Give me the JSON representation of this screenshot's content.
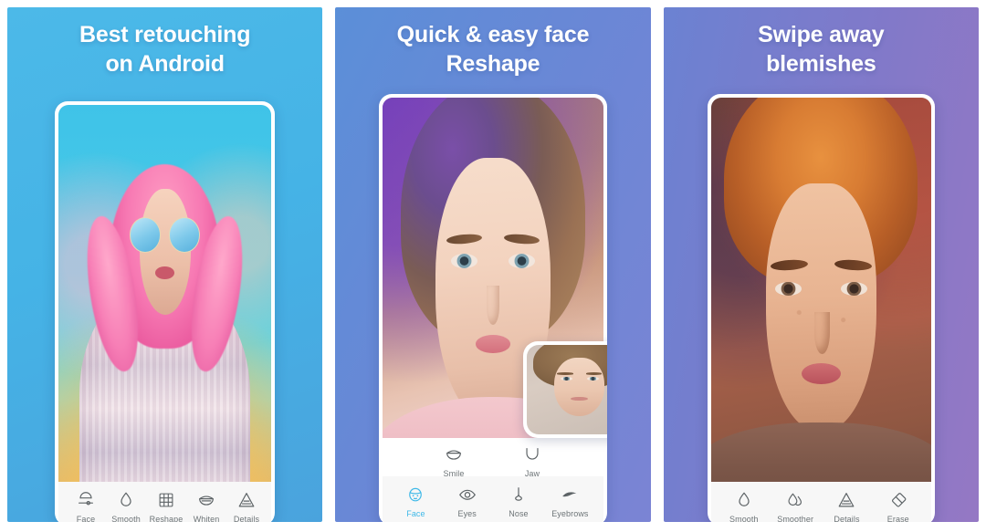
{
  "screenshot": {
    "kind": "app-store-screenshot-strip",
    "panel_count": 3,
    "background": "#ffffff"
  },
  "panels": [
    {
      "id": "panel-best-retouching",
      "headline": "Best retouching\non Android",
      "bg_from": "#4cb9e8",
      "bg_to": "#4aa3dd",
      "photo_alt": "Woman with pink wavy hair, blue tinted round sunglasses, striped pastel sweater on cyan background",
      "toolbar": {
        "rows": 1,
        "active_index": -1,
        "items": [
          {
            "label": "Face",
            "icon": "face-slider-icon",
            "active": false
          },
          {
            "label": "Smooth",
            "icon": "droplet-icon",
            "active": false
          },
          {
            "label": "Reshape",
            "icon": "grid-mesh-icon",
            "active": false
          },
          {
            "label": "Whiten",
            "icon": "teeth-smile-icon",
            "active": false
          },
          {
            "label": "Details",
            "icon": "triangle-layers-icon",
            "active": false
          }
        ]
      }
    },
    {
      "id": "panel-face-reshape",
      "headline": "Quick & easy face\nReshape",
      "bg_from": "#5b8fd8",
      "bg_to": "#7b84d4",
      "photo_alt": "Close-up of woman with light brown hair and purple rim lighting wearing a pink shirt",
      "thumbnail": {
        "label": "before-after-preview",
        "alt": "Small rounded preview of the same woman's face"
      },
      "toolbar": {
        "rows": 2,
        "sub_row": [
          {
            "label": "Smile",
            "icon": "smile-mouth-icon",
            "active": false
          },
          {
            "label": "Jaw",
            "icon": "jaw-outline-icon",
            "active": false
          }
        ],
        "main_row": [
          {
            "label": "Face",
            "icon": "face-head-icon",
            "active": true
          },
          {
            "label": "Eyes",
            "icon": "eye-icon",
            "active": false
          },
          {
            "label": "Nose",
            "icon": "nose-icon",
            "active": false
          },
          {
            "label": "Eyebrows",
            "icon": "eyebrow-icon",
            "active": false
          }
        ],
        "active_label": "Face",
        "active_color": "#3fb9e8"
      }
    },
    {
      "id": "panel-swipe-blemishes",
      "headline": "Swipe away\nblemishes",
      "bg_from": "#6b82d2",
      "bg_to": "#9578c4",
      "photo_alt": "Close-up of freckled woman with curly auburn hair in warm light",
      "toolbar": {
        "rows": 1,
        "active_index": -1,
        "items": [
          {
            "label": "Smooth",
            "icon": "droplet-icon",
            "active": false
          },
          {
            "label": "Smoother",
            "icon": "double-droplet-icon",
            "active": false
          },
          {
            "label": "Details",
            "icon": "triangle-layers-icon",
            "active": false
          },
          {
            "label": "Erase",
            "icon": "eraser-icon",
            "active": false
          }
        ]
      }
    }
  ]
}
